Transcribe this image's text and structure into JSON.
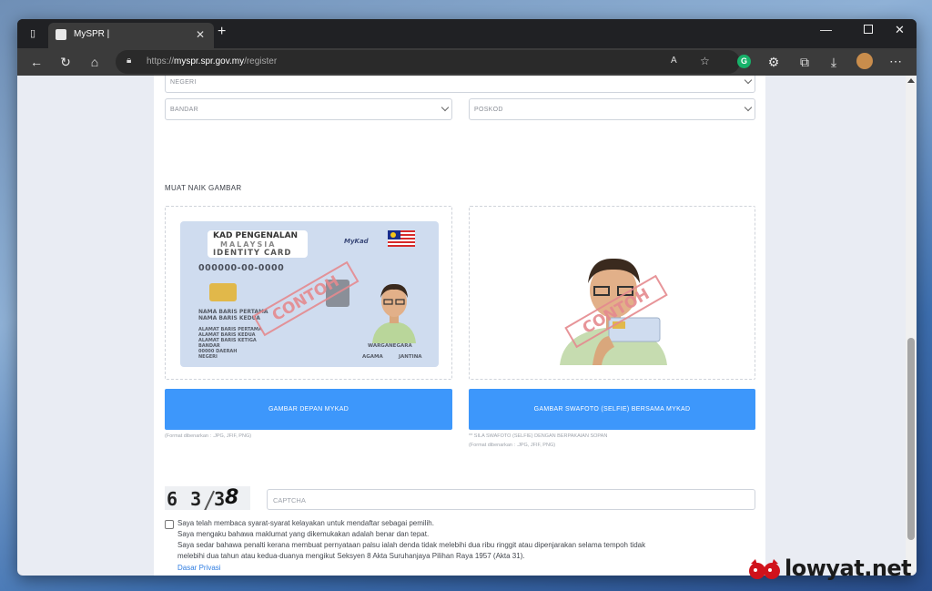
{
  "browser": {
    "tab_title": "MySPR |",
    "new_tab_glyph": "+",
    "url_prefix": "https://",
    "url_domain": "myspr.spr.gov.my",
    "url_path": "/register",
    "extension_badge": "G"
  },
  "form": {
    "negeri_placeholder": "NEGERI",
    "bandar_placeholder": "BANDAR",
    "poskod_placeholder": "POSKOD",
    "section_title": "MUAT NAIK GAMBAR",
    "upload_front_label": "GAMBAR DEPAN MYKAD",
    "upload_selfie_label": "GAMBAR SWAFOTO (SELFIE) BERSAMA MYKAD",
    "front_hint": "(Format dibenarkan : .JPG, JFIF, PNG)",
    "selfie_note": "** SILA SWAFOTO (SELFIE) DENGAN BERPAKAIAN SOPAN",
    "selfie_hint": "(Format dibenarkan : .JPG, JFIF, PNG)",
    "captcha_text": "6 3 3",
    "captcha_last": "8",
    "captcha_placeholder": "CAPTCHA",
    "declaration_lines": [
      "Saya telah membaca syarat-syarat kelayakan untuk mendaftar sebagai pemilih.",
      "Saya mengaku bahawa maklumat yang dikemukakan adalah benar dan tepat.",
      "Saya sedar bahawa penalti kerana membuat pernyataan palsu ialah denda tidak melebihi dua ribu ringgit atau dipenjarakan selama tempoh tidak",
      "melebihi dua tahun atau kedua-duanya mengikut Seksyen 8 Akta Suruhanjaya Pilihan Raya 1957 (Akta 31)."
    ],
    "privacy_link": "Dasar Privasi"
  },
  "mykad_sample": {
    "title_1": "KAD PENGENALAN",
    "title_2": "MALAYSIA",
    "title_3": "IDENTITY CARD",
    "brand": "MyKad",
    "ic_number": "000000-00-0000",
    "name_1": "NAMA BARIS PERTAMA",
    "name_2": "NAMA BARIS KEDUA",
    "addr_1": "ALAMAT BARIS PERTAMA",
    "addr_2": "ALAMAT BARIS KEDUA",
    "addr_3": "ALAMAT BARIS KETIGA",
    "addr_4": "BANDAR",
    "addr_5": "00000 DAERAH",
    "addr_6": "NEGERI",
    "citizenship": "WARGANEGARA",
    "religion": "AGAMA",
    "gender": "JANTINA",
    "stamp": "CONTOH"
  },
  "selfie_sample": {
    "stamp": "CONTOH"
  },
  "watermark": {
    "text": "lowyat.net"
  },
  "colors": {
    "accent_blue": "#3d97fb",
    "stamp_red": "#e58a8f",
    "link_blue": "#2f7de1"
  }
}
